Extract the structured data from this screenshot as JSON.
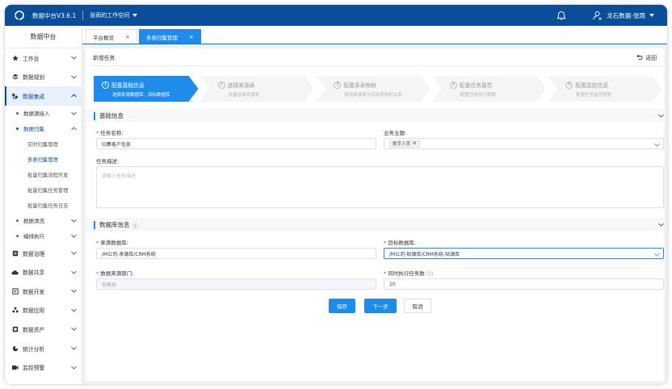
{
  "header": {
    "app_title": "数据中台V3.6.1",
    "workspace": "张雨的工作空间",
    "user": "龙石数据-张雨"
  },
  "sidebar": {
    "title": "数据中台",
    "items": [
      {
        "label": "工作台",
        "icon": "star-icon"
      },
      {
        "label": "数据规划",
        "icon": "layers-icon"
      },
      {
        "label": "数据集成",
        "icon": "integration-icon"
      },
      {
        "label": "数据治理",
        "icon": "governance-icon"
      },
      {
        "label": "数据共享",
        "icon": "cloud-icon"
      },
      {
        "label": "数据开发",
        "icon": "dev-icon"
      },
      {
        "label": "数据应用",
        "icon": "app-icon"
      },
      {
        "label": "数据资产",
        "icon": "asset-icon"
      },
      {
        "label": "统计分析",
        "icon": "pie-icon"
      },
      {
        "label": "监控预警",
        "icon": "monitor-icon"
      }
    ],
    "sub_items": [
      "数据源接入",
      "数据归集",
      "数据清洗",
      "编排执行"
    ],
    "leaf_items": [
      "实时归集管理",
      "多表归集管理",
      "批量归集流程开发",
      "批量归集任务管理",
      "批量归集任务日志"
    ]
  },
  "tabs": [
    {
      "label": "平台概览",
      "close": "×"
    },
    {
      "label": "多表归集管理",
      "close": "×"
    }
  ],
  "page": {
    "title": "新增任务",
    "back": "返回"
  },
  "steps": [
    {
      "num": "1",
      "title": "配置基础信息",
      "desc": "选择来源数据库、目标数据库"
    },
    {
      "num": "2",
      "title": "选择来源表",
      "desc": "批量选择来源表"
    },
    {
      "num": "3",
      "title": "配置多表映射",
      "desc": "修改来源表与目标表映射关系"
    },
    {
      "num": "4",
      "title": "配置任务属性",
      "desc": "配置任务执行策略"
    },
    {
      "num": "5",
      "title": "配置监控信息",
      "desc": "配置任务监控预警"
    }
  ],
  "basic": {
    "section_title": "基础信息",
    "task_name_label": "任务名称:",
    "task_name_value": "归集客户信息",
    "topic_label": "业务主题:",
    "topic_tag": "数字人员",
    "topic_tag_close": "⊗",
    "desc_label": "任务描述:",
    "desc_placeholder": "请输入任务描述"
  },
  "db": {
    "section_title": "数据库信息",
    "info_icon": "ⓘ",
    "src_db_label": "来源数据库:",
    "src_db_value": "/M公司-来源库/CRM系统",
    "tgt_db_label": "目标数据库:",
    "tgt_db_value": "/M公司-贴源库/CRM系统-贴源库",
    "src_dept_label": "数据来源部门:",
    "src_dept_value": "销售部",
    "concurrency_label": "同时执行任务数",
    "concurrency_info": "ⓘ",
    "concurrency_colon": ":",
    "concurrency_value": "10"
  },
  "actions": {
    "save": "保存",
    "next": "下一步",
    "cancel": "取消"
  },
  "colors": {
    "brand": "#0a4d98",
    "primary": "#1f8ceb",
    "required": "#e53935"
  }
}
